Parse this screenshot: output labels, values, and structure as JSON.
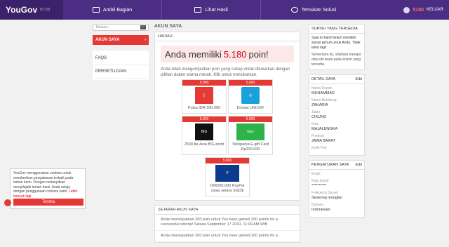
{
  "brand": {
    "logo": "YouGov",
    "lang": "ID | ID"
  },
  "nav": [
    {
      "label": "Ambil Bagian",
      "icon": "survey-icon"
    },
    {
      "label": "Lihat Hasil",
      "icon": "chart-icon"
    },
    {
      "label": "Temukan Solusi",
      "icon": "target-icon"
    }
  ],
  "user": {
    "points": "5180",
    "logout": "KELUAR"
  },
  "left": {
    "search_placeholder": "Telusuri...",
    "active_menu": "AKUN SAYA",
    "links": [
      "FAQS",
      "PERSETUJUAN"
    ]
  },
  "main": {
    "title": "AKUN SAYA",
    "rewards_header": "HADIAH",
    "balance_prefix": "Anda memiliki",
    "balance_value": "5.180",
    "balance_suffix": "poin!",
    "intro": "Anda telah mengumpulkan poin yang cukup untuk ditukarkan dengan pilihan dalam warna merah. Klik untuk menukarkan.",
    "rewards": [
      {
        "cost": "5.000",
        "label": "Pulsa IDR 200.000",
        "icon": "phone-icon"
      },
      {
        "cost": "5.000",
        "label": "Donasi UNICEF",
        "icon": "unicef-icon"
      },
      {
        "cost": "5.000",
        "label": "2500 Air Asia BIG point",
        "icon": "airasia-big-icon"
      },
      {
        "cost": "5.000",
        "label": "Tokopedia E-gift Card Rp200.000",
        "icon": "tokopedia-icon"
      },
      {
        "cost": "5.000",
        "label": "IDR200.000 PayPal (atau setara SGD$",
        "icon": "paypal-icon"
      }
    ],
    "history_header": "SEJARAH AKUN SAYA",
    "history": [
      "Anda mendapatkan 200 poin untuk You have gained 200 points for a successful referral! Selasa September 17 2019, 11:09 AM WIB",
      "Anda mendapatkan 200 poin untuk You have gained 200 points for a"
    ]
  },
  "right": {
    "survey_header": "SURVEI YANG TERSEDIA",
    "survey_text1": "Saat ini kami belum memiliki survei penuh untuk Anda. Tidak lama lagi!",
    "survey_text2": "Sementara itu, silahkan mengisi data diri Anda pada kolom yang tersedia.",
    "details_header": "DETAIL SAYA",
    "edit": "Edit",
    "details": [
      {
        "k": "Nama Depan",
        "v": "MUHAMMAD"
      },
      {
        "k": "Nama Belakang",
        "v": "ZAKARIA"
      },
      {
        "k": "Jalan",
        "v": "CIKUNG"
      },
      {
        "k": "Kota",
        "v": "MAJALENGKA"
      },
      {
        "k": "Provinsi",
        "v": "JAWA BARAT"
      },
      {
        "k": "Kode Pos",
        "v": ""
      }
    ],
    "settings_header": "PENGATURAN SAYA",
    "settings": [
      {
        "k": "Email",
        "v": ""
      },
      {
        "k": "Kata Sandi",
        "v": "**********"
      },
      {
        "k": "Frekuensi Survei",
        "v": "Sesering mungkin"
      },
      {
        "k": "Bahasa",
        "v": "Indonesian"
      }
    ]
  },
  "cookie": {
    "text": "YouGov menggunakan cookies untuk memberikan pengalaman terbaik pada laman kami. Dengan melanjutkan menjelajahi laman kami, Anda setuju dengan penggunaan cookies kami.",
    "link": "Lebih banyak lagi.",
    "accept": "Terima"
  },
  "colors": {
    "brand": "#4b2e83",
    "accent": "#e53935"
  }
}
